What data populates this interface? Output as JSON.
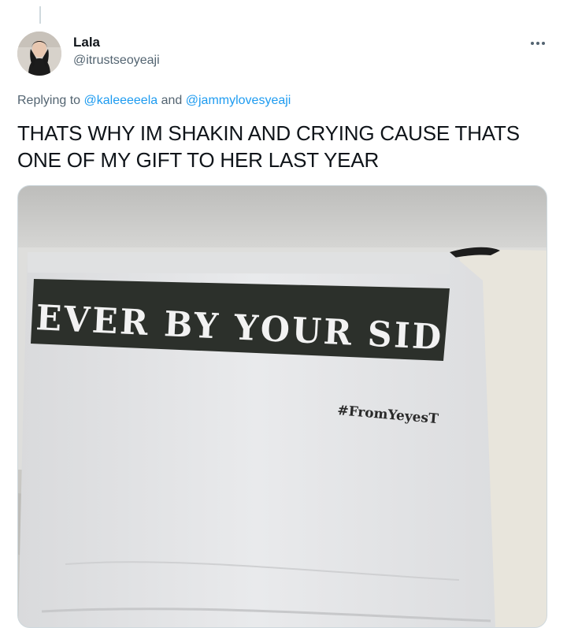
{
  "tweet": {
    "author": {
      "display_name": "Lala",
      "handle": "@itrustseoyeaji"
    },
    "reply_context": {
      "prefix": "Replying to",
      "mention_1": "@kaleeeeela",
      "conjunction": "and",
      "mention_2": "@jammylovesyeaji"
    },
    "text_lines": [
      "THATS WHY IM SHAKIN AND CRYING CAUSE THATS",
      "ONE OF MY GIFT TO HER LAST YEAR"
    ],
    "media": {
      "banner_text": "EVER BY YOUR SID",
      "hashtag_text": "#FromYeyesT"
    }
  },
  "icons": {
    "more": "more-horizontal-icon",
    "avatar": "profile-photo"
  },
  "colors": {
    "link": "#1d9bf0",
    "secondary_text": "#536471",
    "primary_text": "#0f1419"
  }
}
